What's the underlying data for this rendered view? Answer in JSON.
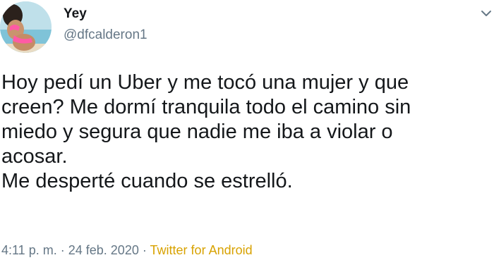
{
  "user": {
    "display_name": "Yey",
    "handle": "@dfcalderon1",
    "avatar_icon": "profile-photo"
  },
  "tweet": {
    "text_lines": [
      "Hoy pedí un Uber y me tocó una mujer y que",
      "creen? Me dormí tranquila todo el camino sin",
      "miedo y segura que nadie me iba a violar o",
      "acosar.",
      "Me desperté cuando se estrelló."
    ]
  },
  "meta": {
    "time": "4:11 p. m.",
    "separator": "·",
    "date": "24 feb. 2020",
    "source": "Twitter for Android"
  },
  "colors": {
    "text": "#14171a",
    "secondary": "#657786",
    "source_link": "#d8a200"
  }
}
